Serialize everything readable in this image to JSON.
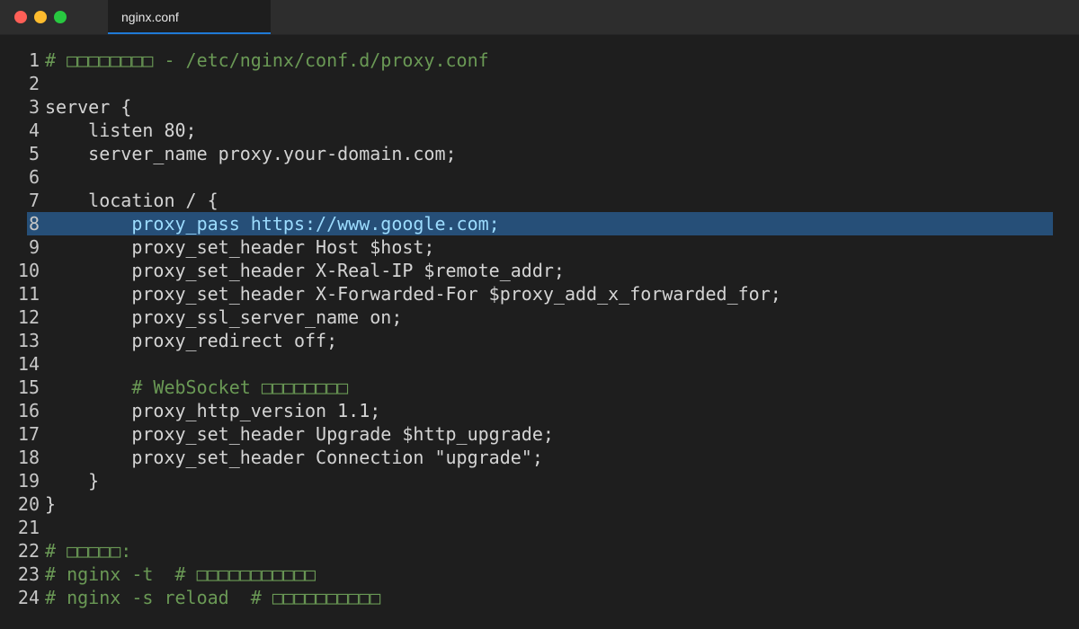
{
  "window": {
    "buttons": [
      "close",
      "minimize",
      "maximize"
    ],
    "colors": {
      "close": "#ff5f57",
      "minimize": "#febc2e",
      "maximize": "#28c840"
    }
  },
  "tab": {
    "label": "nginx.conf",
    "active_accent": "#1f7ad6"
  },
  "editor": {
    "highlighted_line": 8,
    "lines": [
      {
        "n": "1",
        "text": "# □□□□□□□□ - /etc/nginx/conf.d/proxy.conf"
      },
      {
        "n": "2",
        "text": ""
      },
      {
        "n": "3",
        "text": "server {"
      },
      {
        "n": "4",
        "text": "    listen 80;"
      },
      {
        "n": "5",
        "text": "    server_name proxy.your-domain.com;"
      },
      {
        "n": "6",
        "text": ""
      },
      {
        "n": "7",
        "text": "    location / {"
      },
      {
        "n": "8",
        "text": "        proxy_pass https://www.google.com;"
      },
      {
        "n": "9",
        "text": "        proxy_set_header Host $host;"
      },
      {
        "n": "10",
        "text": "        proxy_set_header X-Real-IP $remote_addr;"
      },
      {
        "n": "11",
        "text": "        proxy_set_header X-Forwarded-For $proxy_add_x_forwarded_for;"
      },
      {
        "n": "12",
        "text": "        proxy_ssl_server_name on;"
      },
      {
        "n": "13",
        "text": "        proxy_redirect off;"
      },
      {
        "n": "14",
        "text": ""
      },
      {
        "n": "15",
        "text": "        # WebSocket □□□□□□□□"
      },
      {
        "n": "16",
        "text": "        proxy_http_version 1.1;"
      },
      {
        "n": "17",
        "text": "        proxy_set_header Upgrade $http_upgrade;"
      },
      {
        "n": "18",
        "text": "        proxy_set_header Connection \"upgrade\";"
      },
      {
        "n": "19",
        "text": "    }"
      },
      {
        "n": "20",
        "text": "}"
      },
      {
        "n": "21",
        "text": ""
      },
      {
        "n": "22",
        "text": "# □□□□□:"
      },
      {
        "n": "23",
        "text": "# nginx -t  # □□□□□□□□□□□"
      },
      {
        "n": "24",
        "text": "# nginx -s reload  # □□□□□□□□□□"
      }
    ]
  }
}
